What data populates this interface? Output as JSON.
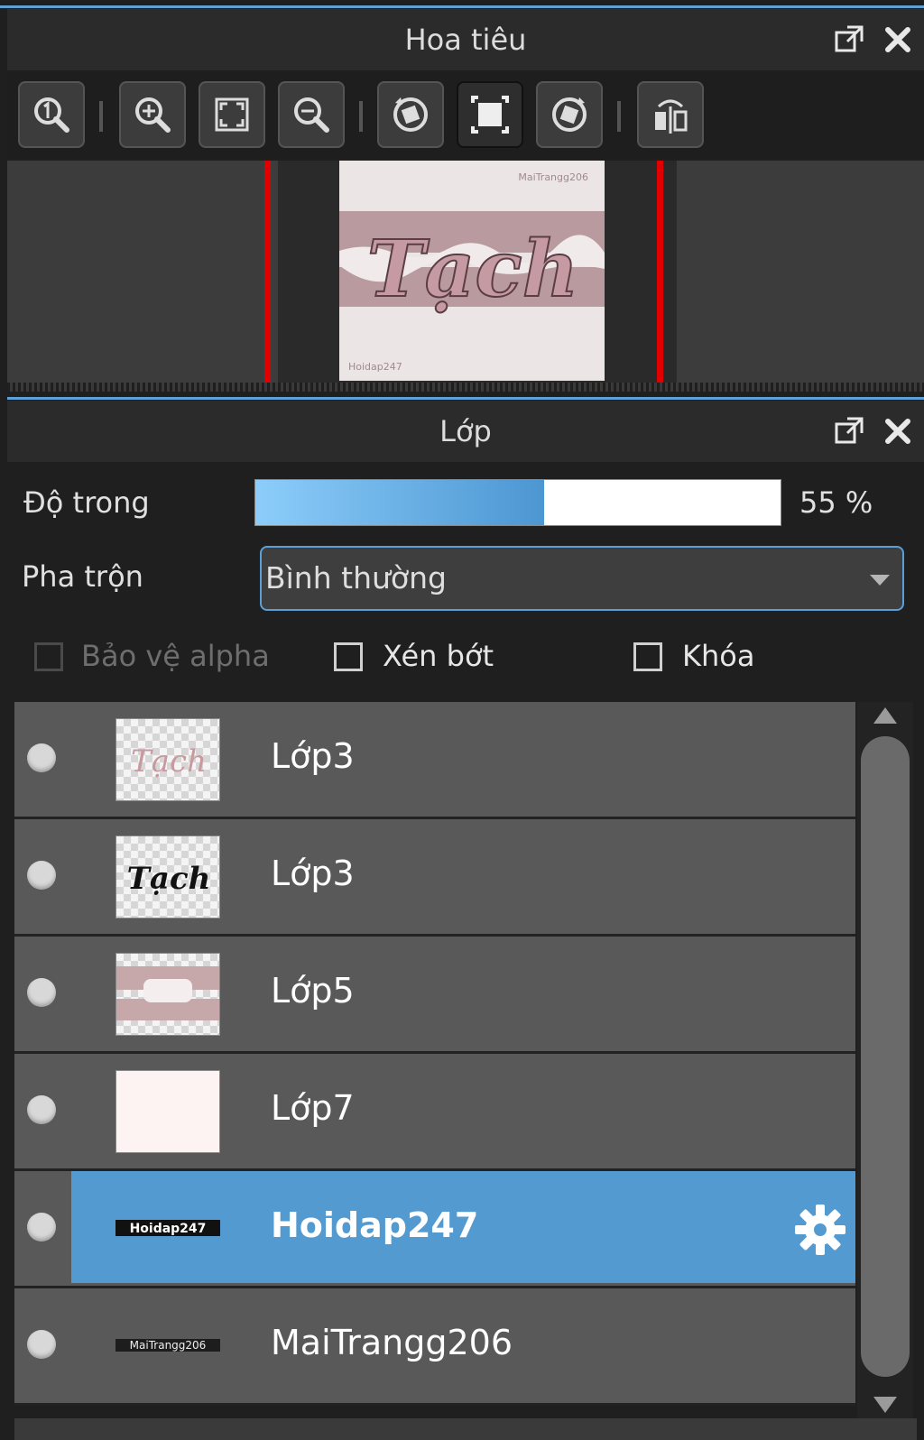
{
  "navigator": {
    "title": "Hoa tiêu",
    "toolbar_icons": [
      "zoom-actual-size-icon",
      "zoom-in-icon",
      "fit-to-window-icon",
      "zoom-out-icon",
      "rotate-left-icon",
      "reset-view-icon",
      "rotate-right-icon",
      "flip-horizontal-icon"
    ],
    "preview": {
      "main_text": "Tạch",
      "watermark_top": "MaiTrangg206",
      "watermark_bottom": "Hoidap247"
    }
  },
  "layers": {
    "title": "Lớp",
    "opacity_label": "Độ trong",
    "opacity_value": "55 %",
    "opacity_fraction": 0.55,
    "blend_label": "Pha trộn",
    "blend_value": "Bình thường",
    "checkboxes": {
      "protect_alpha": "Bảo vệ alpha",
      "clipping": "Xén bớt",
      "lock": "Khóa"
    },
    "items": [
      {
        "name": "Lớp3",
        "thumb_text": "Tạch"
      },
      {
        "name": "Lớp3",
        "thumb_text": "Tạch"
      },
      {
        "name": "Lớp5"
      },
      {
        "name": "Lớp7"
      },
      {
        "name": "Hoidap247",
        "thumb_text": "Hoidap247",
        "selected": true
      },
      {
        "name": "MaiTrangg206",
        "thumb_text": "MaiTrangg206"
      }
    ]
  },
  "colors": {
    "accent": "#539ad1",
    "panel_header": "#2b2b2b",
    "layer_row": "#595959",
    "guide_red": "#e00000"
  }
}
